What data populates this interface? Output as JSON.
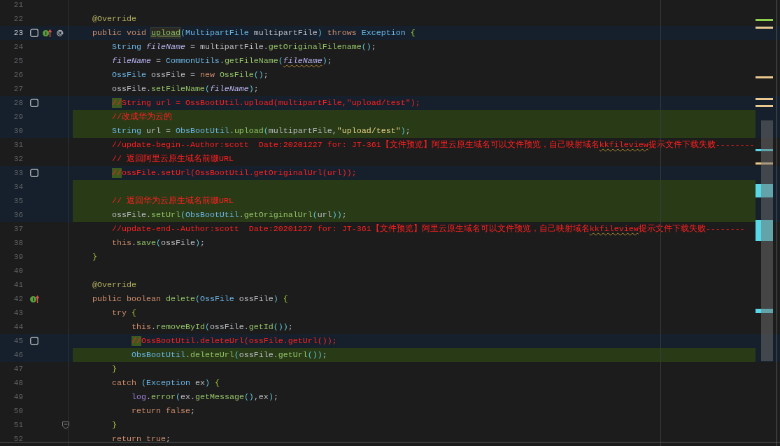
{
  "editor": {
    "lines": [
      {
        "number": "21",
        "kind": "plain",
        "current": false
      },
      {
        "number": "22",
        "kind": "plain",
        "current": false,
        "tokens": [
          {
            "kind": "ann",
            "text": "    @Override"
          }
        ]
      },
      {
        "number": "23",
        "kind": "modified",
        "current": true,
        "gutter_icons": [
          {
            "kind": "square"
          },
          {
            "kind": "override"
          },
          {
            "kind": "at"
          }
        ],
        "tokens": [
          {
            "kind": "kw",
            "text": "    public void "
          },
          {
            "kind": "decl",
            "text": "upload"
          },
          {
            "kind": "paren",
            "text": "("
          },
          {
            "kind": "type",
            "text": "MultipartFile"
          },
          {
            "kind": "var",
            "text": " multipartFile"
          },
          {
            "kind": "paren",
            "text": ")"
          },
          {
            "kind": "kw",
            "text": " throws "
          },
          {
            "kind": "type",
            "text": "Exception"
          },
          {
            "kind": "brace",
            "text": " {"
          }
        ]
      },
      {
        "number": "24",
        "kind": "plain",
        "current": false,
        "tokens": [
          {
            "kind": "type",
            "text": "        String "
          },
          {
            "kind": "param",
            "text": "fileName"
          },
          {
            "kind": "var",
            "text": " = multipartFile."
          },
          {
            "kind": "fn",
            "text": "getOriginalFilename"
          },
          {
            "kind": "paren",
            "text": "()"
          },
          {
            "kind": "var",
            "text": ";"
          }
        ]
      },
      {
        "number": "25",
        "kind": "plain",
        "current": false,
        "tokens": [
          {
            "kind": "param",
            "text": "        fileName"
          },
          {
            "kind": "var",
            "text": " = "
          },
          {
            "kind": "type",
            "text": "CommonUtils"
          },
          {
            "kind": "var",
            "text": "."
          },
          {
            "kind": "fn",
            "text": "getFileName"
          },
          {
            "kind": "paren",
            "text": "("
          },
          {
            "kind": "param_squiggle",
            "text": "fileName"
          },
          {
            "kind": "paren",
            "text": ")"
          },
          {
            "kind": "var",
            "text": ";"
          }
        ]
      },
      {
        "number": "26",
        "kind": "plain",
        "current": false,
        "tokens": [
          {
            "kind": "type",
            "text": "        OssFile"
          },
          {
            "kind": "var",
            "text": " ossFile = "
          },
          {
            "kind": "kw",
            "text": "new "
          },
          {
            "kind": "fn",
            "text": "OssFile"
          },
          {
            "kind": "paren",
            "text": "()"
          },
          {
            "kind": "var",
            "text": ";"
          }
        ]
      },
      {
        "number": "27",
        "kind": "plain",
        "current": false,
        "tokens": [
          {
            "kind": "var",
            "text": "        ossFile."
          },
          {
            "kind": "fn",
            "text": "setFileName"
          },
          {
            "kind": "paren",
            "text": "("
          },
          {
            "kind": "param",
            "text": "fileName"
          },
          {
            "kind": "paren",
            "text": ")"
          },
          {
            "kind": "var",
            "text": ";"
          }
        ]
      },
      {
        "number": "28",
        "kind": "modified",
        "current": false,
        "gutter_icons": [
          {
            "kind": "square"
          }
        ],
        "tokens": [
          {
            "kind": "cmt_added",
            "text": "        //"
          },
          {
            "kind": "cmt",
            "text": "String url = OssBootUtil.upload(multipartFile,\"upload/test\");"
          }
        ]
      },
      {
        "number": "29",
        "kind": "added",
        "current": false,
        "tokens": [
          {
            "kind": "cmt",
            "text": "        //改成华为云的"
          }
        ]
      },
      {
        "number": "30",
        "kind": "added",
        "current": false,
        "tokens": [
          {
            "kind": "type",
            "text": "        String "
          },
          {
            "kind": "var",
            "text": "url = "
          },
          {
            "kind": "type",
            "text": "ObsBootUtil"
          },
          {
            "kind": "var",
            "text": "."
          },
          {
            "kind": "fn",
            "text": "upload"
          },
          {
            "kind": "paren",
            "text": "("
          },
          {
            "kind": "var",
            "text": "multipartFile,"
          },
          {
            "kind": "str",
            "text": "\"upload/test\""
          },
          {
            "kind": "paren",
            "text": ")"
          },
          {
            "kind": "var",
            "text": ";"
          }
        ]
      },
      {
        "number": "31",
        "kind": "plain",
        "current": false,
        "tokens": [
          {
            "kind": "cmt",
            "text": "        //update-begin--Author:scott  Date:20201227 for: JT-361【文件预览】阿里云原生域名可以文件预览，自己映射域名"
          },
          {
            "kind": "cmt_squiggle",
            "text": "kkfileview"
          },
          {
            "kind": "cmt",
            "text": "提示文件下载失败--------"
          }
        ]
      },
      {
        "number": "32",
        "kind": "plain",
        "current": false,
        "tokens": [
          {
            "kind": "cmt",
            "text": "        // 返回阿里云原生域名前缀URL"
          }
        ]
      },
      {
        "number": "33",
        "kind": "modified",
        "current": false,
        "gutter_icons": [
          {
            "kind": "square"
          }
        ],
        "tokens": [
          {
            "kind": "cmt_added",
            "text": "        //"
          },
          {
            "kind": "cmt",
            "text": "ossFile.setUrl(OssBootUtil.getOriginalUrl(url));"
          }
        ]
      },
      {
        "number": "34",
        "kind": "added",
        "current": false
      },
      {
        "number": "35",
        "kind": "added",
        "current": false,
        "tokens": [
          {
            "kind": "cmt",
            "text": "        // 返回华为云原生域名前缀URL"
          }
        ]
      },
      {
        "number": "36",
        "kind": "added",
        "current": false,
        "tokens": [
          {
            "kind": "var",
            "text": "        ossFile."
          },
          {
            "kind": "fn",
            "text": "setUrl"
          },
          {
            "kind": "paren",
            "text": "("
          },
          {
            "kind": "type",
            "text": "ObsBootUtil"
          },
          {
            "kind": "var",
            "text": "."
          },
          {
            "kind": "fn",
            "text": "getOriginalUrl"
          },
          {
            "kind": "paren",
            "text": "("
          },
          {
            "kind": "var",
            "text": "url"
          },
          {
            "kind": "paren",
            "text": "))"
          },
          {
            "kind": "var",
            "text": ";"
          }
        ]
      },
      {
        "number": "37",
        "kind": "plain",
        "current": false,
        "tokens": [
          {
            "kind": "cmt",
            "text": "        //update-end--Author:scott  Date:20201227 for: JT-361【文件预览】阿里云原生域名可以文件预览，自己映射域名"
          },
          {
            "kind": "cmt_squiggle",
            "text": "kkfileview"
          },
          {
            "kind": "cmt",
            "text": "提示文件下载失败--------"
          }
        ]
      },
      {
        "number": "38",
        "kind": "plain",
        "current": false,
        "tokens": [
          {
            "kind": "kw",
            "text": "        this"
          },
          {
            "kind": "var",
            "text": "."
          },
          {
            "kind": "fn",
            "text": "save"
          },
          {
            "kind": "paren",
            "text": "("
          },
          {
            "kind": "var",
            "text": "ossFile"
          },
          {
            "kind": "paren",
            "text": ")"
          },
          {
            "kind": "var",
            "text": ";"
          }
        ]
      },
      {
        "number": "39",
        "kind": "plain",
        "current": false,
        "tokens": [
          {
            "kind": "brace",
            "text": "    }"
          }
        ]
      },
      {
        "number": "40",
        "kind": "plain",
        "current": false
      },
      {
        "number": "41",
        "kind": "plain",
        "current": false,
        "tokens": [
          {
            "kind": "ann",
            "text": "    @Override"
          }
        ]
      },
      {
        "number": "42",
        "kind": "plain",
        "current": false,
        "gutter_icons": [
          {
            "kind": "override"
          }
        ],
        "tokens": [
          {
            "kind": "kw",
            "text": "    public boolean "
          },
          {
            "kind": "fn",
            "text": "delete"
          },
          {
            "kind": "paren",
            "text": "("
          },
          {
            "kind": "type",
            "text": "OssFile"
          },
          {
            "kind": "var",
            "text": " ossFile"
          },
          {
            "kind": "paren",
            "text": ")"
          },
          {
            "kind": "brace",
            "text": " {"
          }
        ]
      },
      {
        "number": "43",
        "kind": "plain",
        "current": false,
        "tokens": [
          {
            "kind": "kw",
            "text": "        try "
          },
          {
            "kind": "brace",
            "text": "{"
          }
        ]
      },
      {
        "number": "44",
        "kind": "plain",
        "current": false,
        "tokens": [
          {
            "kind": "kw",
            "text": "            this"
          },
          {
            "kind": "var",
            "text": "."
          },
          {
            "kind": "fn",
            "text": "removeById"
          },
          {
            "kind": "paren",
            "text": "("
          },
          {
            "kind": "var",
            "text": "ossFile."
          },
          {
            "kind": "fn",
            "text": "getId"
          },
          {
            "kind": "paren",
            "text": "())"
          },
          {
            "kind": "var",
            "text": ";"
          }
        ]
      },
      {
        "number": "45",
        "kind": "modified",
        "current": false,
        "gutter_icons": [
          {
            "kind": "square"
          }
        ],
        "tokens": [
          {
            "kind": "cmt_added",
            "text": "            //"
          },
          {
            "kind": "cmt",
            "text": "OssBootUtil.deleteUrl(ossFile.getUrl());"
          }
        ]
      },
      {
        "number": "46",
        "kind": "added",
        "current": false,
        "tokens": [
          {
            "kind": "type",
            "text": "            ObsBootUtil"
          },
          {
            "kind": "var",
            "text": "."
          },
          {
            "kind": "fn",
            "text": "deleteUrl"
          },
          {
            "kind": "paren",
            "text": "("
          },
          {
            "kind": "var",
            "text": "ossFile."
          },
          {
            "kind": "fn",
            "text": "getUrl"
          },
          {
            "kind": "paren",
            "text": "())"
          },
          {
            "kind": "var",
            "text": ";"
          }
        ]
      },
      {
        "number": "47",
        "kind": "plain",
        "current": false,
        "tokens": [
          {
            "kind": "brace",
            "text": "        }"
          }
        ]
      },
      {
        "number": "48",
        "kind": "plain",
        "current": false,
        "tokens": [
          {
            "kind": "kw",
            "text": "        catch "
          },
          {
            "kind": "paren",
            "text": "("
          },
          {
            "kind": "type",
            "text": "Exception"
          },
          {
            "kind": "var",
            "text": " ex"
          },
          {
            "kind": "paren",
            "text": ")"
          },
          {
            "kind": "brace",
            "text": " {"
          }
        ]
      },
      {
        "number": "49",
        "kind": "plain",
        "current": false,
        "tokens": [
          {
            "kind": "field",
            "text": "            log"
          },
          {
            "kind": "var",
            "text": "."
          },
          {
            "kind": "fn",
            "text": "error"
          },
          {
            "kind": "paren",
            "text": "("
          },
          {
            "kind": "var",
            "text": "ex."
          },
          {
            "kind": "fn",
            "text": "getMessage"
          },
          {
            "kind": "paren",
            "text": "()"
          },
          {
            "kind": "var",
            "text": ",ex"
          },
          {
            "kind": "paren",
            "text": ")"
          },
          {
            "kind": "var",
            "text": ";"
          }
        ]
      },
      {
        "number": "50",
        "kind": "plain",
        "current": false,
        "tokens": [
          {
            "kind": "kw",
            "text": "            return false"
          },
          {
            "kind": "var",
            "text": ";"
          }
        ]
      },
      {
        "number": "51",
        "kind": "plain",
        "current": false,
        "gutter_icons": [
          {
            "kind": "fold"
          }
        ],
        "tokens": [
          {
            "kind": "brace",
            "text": "        }"
          }
        ]
      },
      {
        "number": "52",
        "kind": "plain",
        "current": false,
        "tokens": [
          {
            "kind": "kw",
            "text": "        return true"
          },
          {
            "kind": "var",
            "text": ";"
          }
        ]
      }
    ]
  }
}
